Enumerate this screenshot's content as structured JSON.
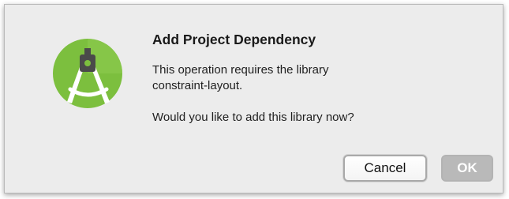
{
  "dialog": {
    "title": "Add Project Dependency",
    "message_line1": "This operation requires the library",
    "message_line2": "constraint-layout.",
    "question": "Would you like to add this library now?",
    "icon": "android-studio-icon"
  },
  "buttons": {
    "cancel_label": "Cancel",
    "ok_label": "OK"
  },
  "colors": {
    "dialog_bg": "#ececec",
    "logo_green": "#7cbf3e",
    "ok_button_bg": "#b9b9b9"
  }
}
